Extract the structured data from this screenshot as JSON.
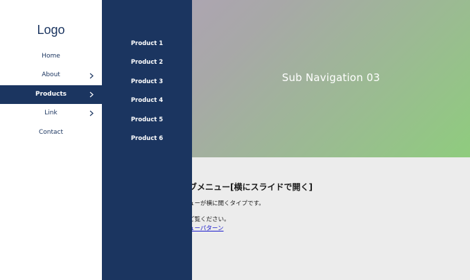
{
  "hero": {
    "title": "Sub Navigation 03"
  },
  "content": {
    "heading": "ブメニュー[横にスライドで開く]",
    "text1": "ューが横に開くタイプです。",
    "text2": "ご覧ください。",
    "link": "ューパターン"
  },
  "sidebar": {
    "logo": "Logo",
    "items": [
      {
        "label": "Home",
        "has_chevron": false
      },
      {
        "label": "About",
        "has_chevron": true
      },
      {
        "label": "Products",
        "has_chevron": true,
        "active": true
      },
      {
        "label": "Link",
        "has_chevron": true
      },
      {
        "label": "Contact",
        "has_chevron": false
      }
    ]
  },
  "subnav": {
    "items": [
      {
        "label": "Product 1"
      },
      {
        "label": "Product 2"
      },
      {
        "label": "Product 3"
      },
      {
        "label": "Product 4"
      },
      {
        "label": "Product 5"
      },
      {
        "label": "Product 6"
      }
    ]
  },
  "colors": {
    "navy": "#1b3560",
    "content_bg": "#ececec",
    "hero_gradient_start": "#b79fc3",
    "hero_gradient_end": "#8fcc7e",
    "link": "#1a1acc"
  },
  "icons": {
    "chevron": "chevron-right-icon"
  }
}
